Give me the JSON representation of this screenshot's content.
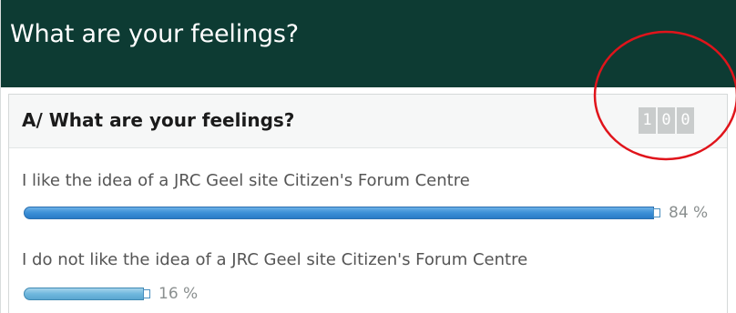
{
  "header": {
    "title": "What are your feelings?"
  },
  "question": {
    "title": "A/ What are your feelings?",
    "counter_digits": [
      "1",
      "0",
      "0"
    ]
  },
  "options": [
    {
      "label": "I like the idea of a JRC Geel site Citizen's Forum Centre",
      "percent": 84,
      "percent_text": "84 %"
    },
    {
      "label": "I do not like the idea of a JRC Geel site Citizen's Forum Centre",
      "percent": 16,
      "percent_text": "16 %"
    }
  ],
  "colors": {
    "header_bg": "#0d3b33",
    "bar_primary": "#3b8fd6",
    "bar_secondary": "#6fb7dd",
    "annotation": "#e0141b"
  }
}
